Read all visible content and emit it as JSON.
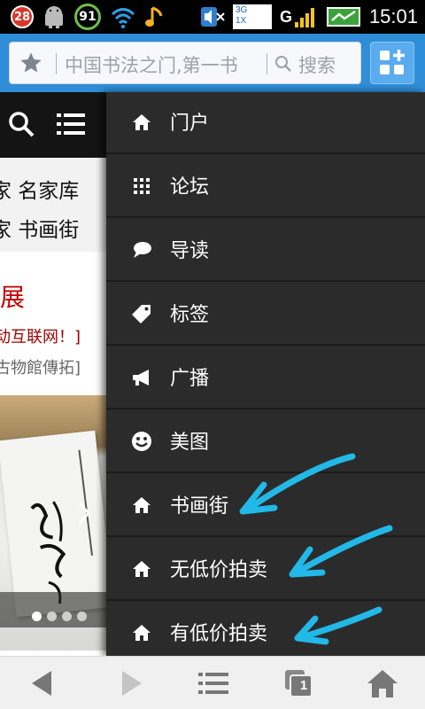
{
  "status_bar": {
    "notification_count": "28",
    "battery_level": "91",
    "network_badge_top": "3G",
    "network_badge_bottom": "1X",
    "time": "15:01",
    "icons": [
      "android-icon",
      "wifi-icon",
      "music-icon",
      "mute-icon",
      "signal-icon",
      "signal-g-icon",
      "battery-icon"
    ]
  },
  "toolbar": {
    "url_text": "中国书法之门,第一书",
    "search_label": "搜索",
    "apps_button_icon": "apps-plus-icon"
  },
  "page": {
    "nav_rows": [
      "家 名家库",
      "家 书画街"
    ],
    "title": "展",
    "line1": "动互联网！]",
    "line2": "古物館傳拓]",
    "carousel_slide_count": 4,
    "carousel_active_index": 0
  },
  "drawer": {
    "items": [
      {
        "label": "门户",
        "icon": "home-icon"
      },
      {
        "label": "论坛",
        "icon": "grid-icon"
      },
      {
        "label": "导读",
        "icon": "chat-bubble-icon"
      },
      {
        "label": "标签",
        "icon": "tag-icon"
      },
      {
        "label": "广播",
        "icon": "megaphone-icon"
      },
      {
        "label": "美图",
        "icon": "smiley-icon"
      },
      {
        "label": "书画街",
        "icon": "home-icon"
      },
      {
        "label": "无低价拍卖",
        "icon": "home-icon"
      },
      {
        "label": "有低价拍卖",
        "icon": "home-icon"
      }
    ]
  },
  "bottom_bar": {
    "tab_count": "1",
    "buttons": [
      "back-icon",
      "forward-icon",
      "menu-icon",
      "tabs-icon",
      "home-icon"
    ]
  },
  "colors": {
    "toolbar_blue": "#2f8ed7",
    "drawer_bg": "#2b2b2b",
    "annotation_cyan": "#22b8e8",
    "accent_red": "#c10000"
  }
}
